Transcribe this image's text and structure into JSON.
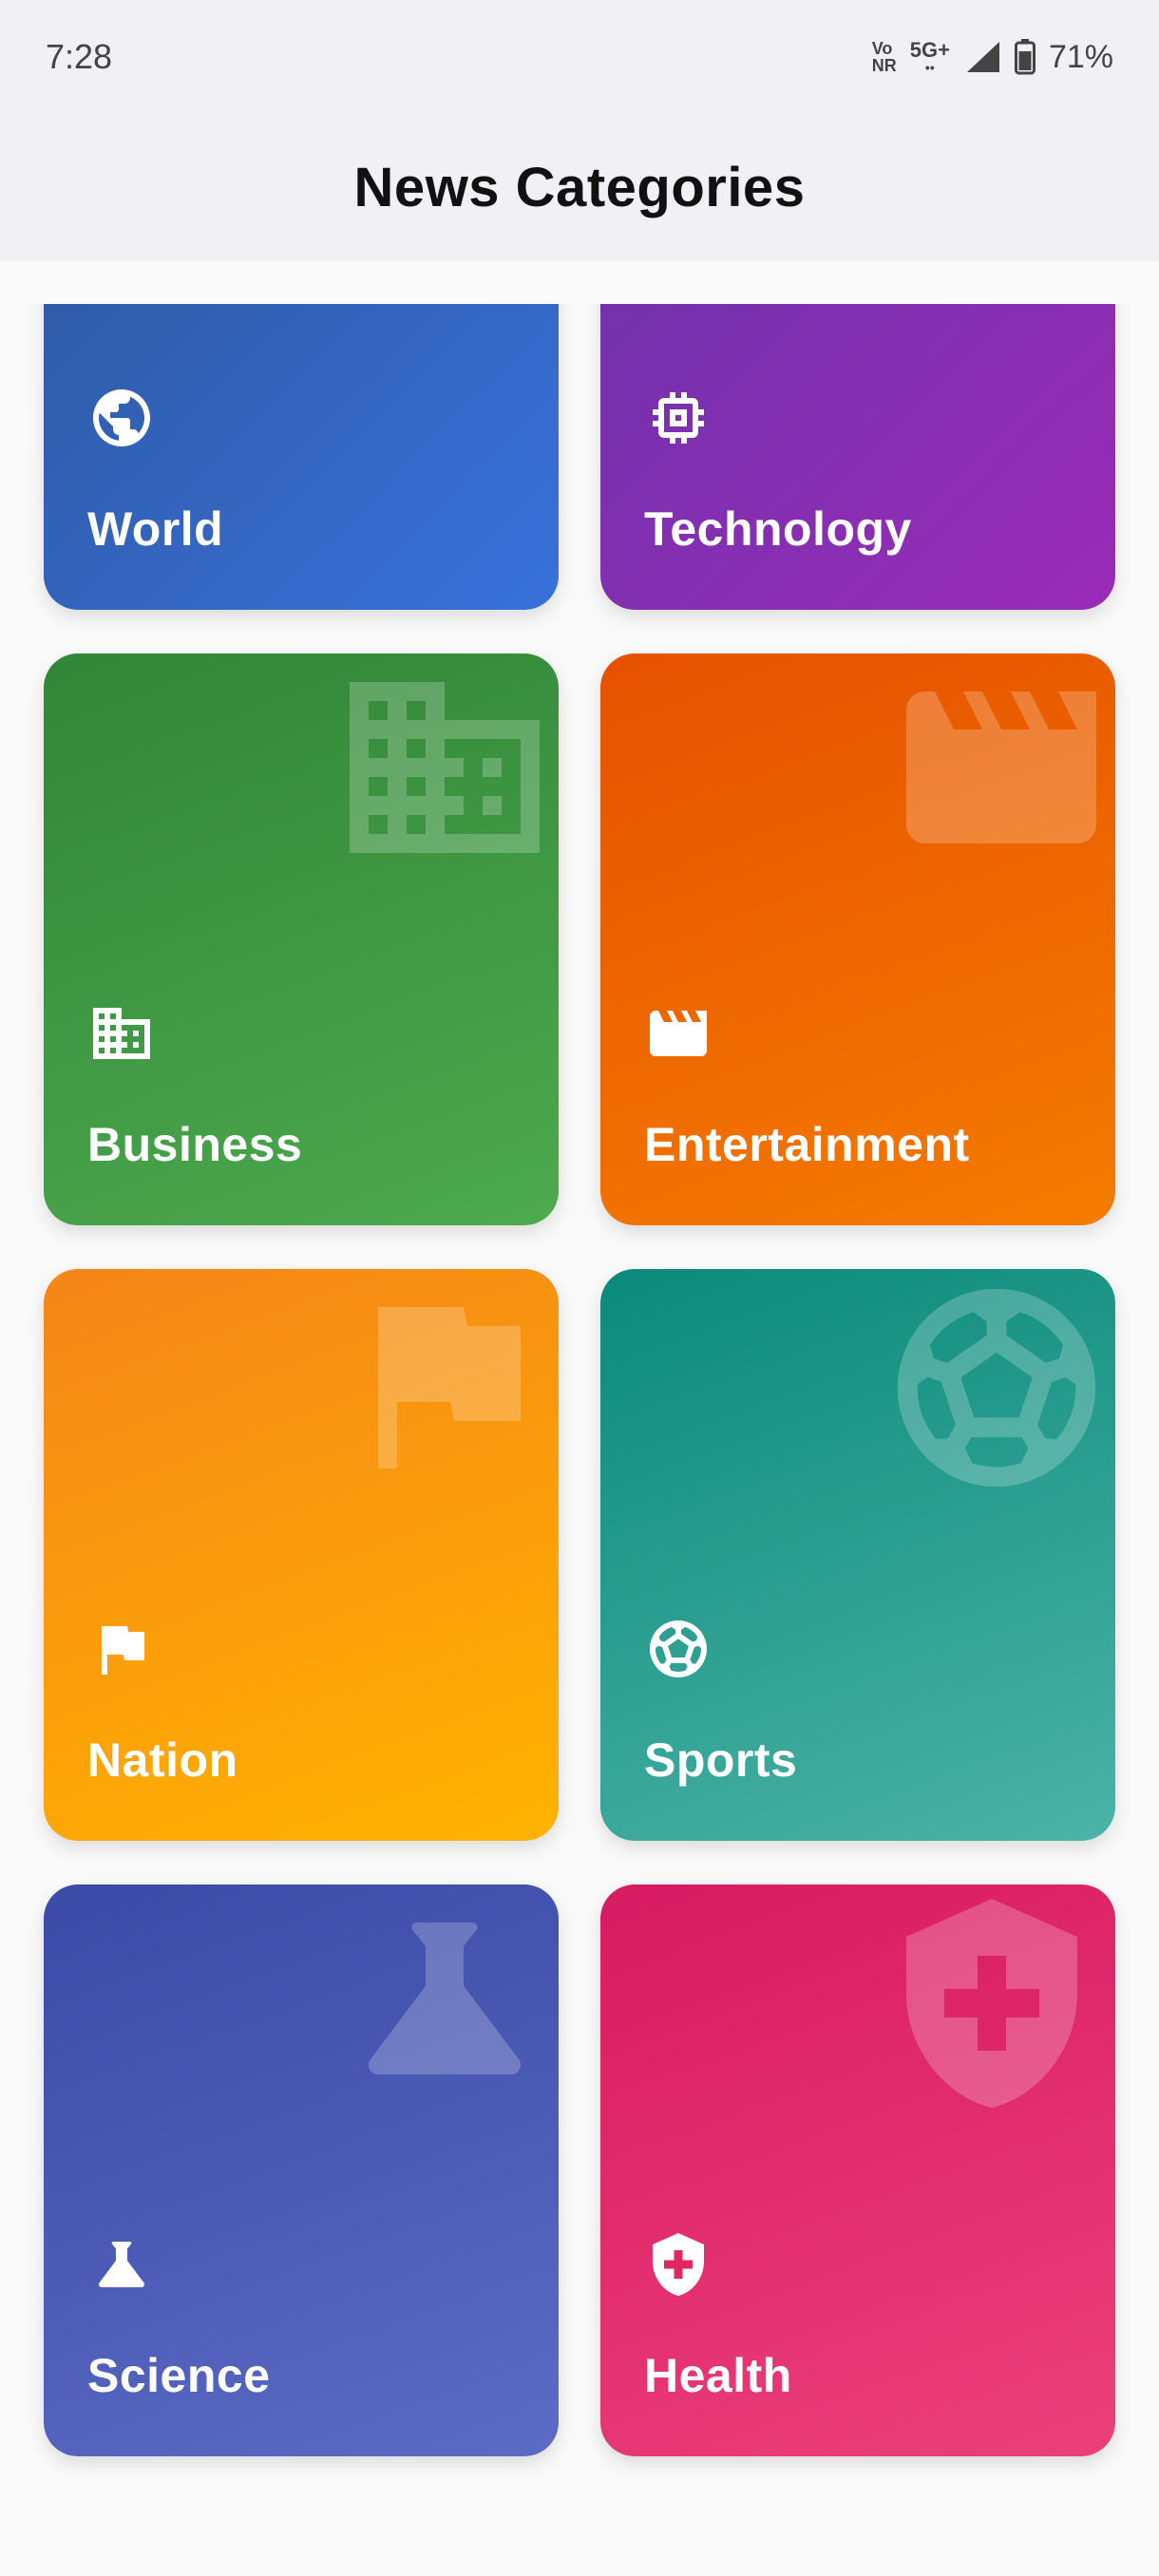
{
  "status_bar": {
    "time": "7:28",
    "volte_top": "Vo",
    "volte_bottom": "NR",
    "network": "5G+",
    "network_sub": "••",
    "battery": "71%"
  },
  "app_bar": {
    "title": "News Categories"
  },
  "categories": [
    {
      "label": "World",
      "icon": "globe-icon",
      "color_from": "#2d5597",
      "color_to": "#3871dc"
    },
    {
      "label": "Technology",
      "icon": "chip-icon",
      "color_from": "#6634a8",
      "color_to": "#9a2bb8"
    },
    {
      "label": "Business",
      "icon": "building-icon",
      "color_from": "#318537",
      "color_to": "#4daa4f"
    },
    {
      "label": "Entertainment",
      "icon": "clapperboard-icon",
      "color_from": "#e65100",
      "color_to": "#f57c00"
    },
    {
      "label": "Nation",
      "icon": "flag-icon",
      "color_from": "#f58518",
      "color_to": "#ffb300"
    },
    {
      "label": "Sports",
      "icon": "soccer-ball-icon",
      "color_from": "#0a8a7a",
      "color_to": "#4bb3a7"
    },
    {
      "label": "Science",
      "icon": "flask-icon",
      "color_from": "#3a4aa6",
      "color_to": "#5c6bc4"
    },
    {
      "label": "Health",
      "icon": "health-shield-icon",
      "color_from": "#d81b60",
      "color_to": "#ec407a"
    }
  ]
}
